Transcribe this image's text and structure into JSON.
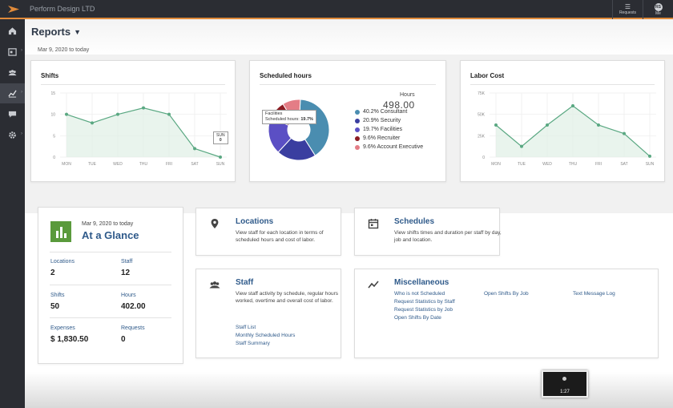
{
  "topbar": {
    "company": "Perform Design LTD",
    "requests_label": "Requests",
    "me_label": "Me",
    "avatar_initials": "RS"
  },
  "sidebar": {
    "items": [
      {
        "icon": "home-icon"
      },
      {
        "icon": "schedule-icon"
      },
      {
        "icon": "people-icon"
      },
      {
        "icon": "reports-icon",
        "active": true
      },
      {
        "icon": "messages-icon"
      },
      {
        "icon": "settings-icon"
      }
    ]
  },
  "header": {
    "title": "Reports",
    "date_range": "Mar 9, 2020 to today"
  },
  "chart_data": [
    {
      "type": "area",
      "title": "Shifts",
      "categories": [
        "MON",
        "TUE",
        "WED",
        "THU",
        "FRI",
        "SAT",
        "SUN"
      ],
      "values": [
        10,
        8,
        10,
        11.5,
        10,
        2,
        0
      ],
      "yticks": [
        "0",
        "5",
        "10",
        "15"
      ],
      "ylim": [
        0,
        15
      ],
      "tooltip": {
        "category": "SUN",
        "value": "0"
      },
      "color": "#5aa882"
    },
    {
      "type": "pie",
      "title": "Scheduled hours",
      "total_label": "Hours",
      "total_value": "498.00",
      "slices": [
        {
          "label": "40.2% Consultant",
          "value": 40.2,
          "color": "#4a8db0"
        },
        {
          "label": "20.9% Security",
          "value": 20.9,
          "color": "#3a3ea0"
        },
        {
          "label": "19.7% Facilities",
          "value": 19.7,
          "color": "#5b4fc4"
        },
        {
          "label": "9.6% Recruiter",
          "value": 9.6,
          "color": "#8c1b22"
        },
        {
          "label": "9.6% Account Executive",
          "value": 9.6,
          "color": "#e47d86"
        }
      ],
      "tooltip": {
        "title": "Facilities",
        "label": "Scheduled hours:",
        "value": "19.7%"
      }
    },
    {
      "type": "area",
      "title": "Labor Cost",
      "categories": [
        "MON",
        "TUE",
        "WED",
        "THU",
        "FRI",
        "SAT",
        "SUN"
      ],
      "values": [
        375,
        125,
        375,
        600,
        375,
        275,
        10
      ],
      "yticks": [
        "0",
        "25K",
        "50K",
        "75K"
      ],
      "ylim": [
        0,
        750
      ],
      "color": "#5aa882"
    }
  ],
  "glance": {
    "date": "Mar 9, 2020 to today",
    "title": "At a Glance",
    "stats": [
      {
        "label": "Locations",
        "value": "2"
      },
      {
        "label": "Staff",
        "value": "12"
      },
      {
        "label": "Shifts",
        "value": "50"
      },
      {
        "label": "Hours",
        "value": "402.00"
      },
      {
        "label": "Expenses",
        "value": "$ 1,830.50"
      },
      {
        "label": "Requests",
        "value": "0"
      }
    ]
  },
  "tiles": {
    "locations": {
      "title": "Locations",
      "desc": "View staff for each location in terms of scheduled hours and cost of labor."
    },
    "schedules": {
      "title": "Schedules",
      "desc": "View shifts times and duration per staff by day, job and location."
    },
    "staff": {
      "title": "Staff",
      "desc": "View staff activity by schedule, regular hours worked, overtime and overall cost of labor.",
      "links": [
        "Staff List",
        "Monthly Scheduled Hours",
        "Staff Summary"
      ]
    },
    "misc": {
      "title": "Miscellaneous",
      "links_col1": [
        "Who is not Scheduled",
        "Request Statistics by Staff",
        "Request Statistics by Job",
        "Open Shifts By Date"
      ],
      "links_col2": [
        "Open Shifts By Job"
      ],
      "links_col3": [
        "Text Message Log"
      ]
    }
  },
  "video": {
    "time": "1:27"
  }
}
